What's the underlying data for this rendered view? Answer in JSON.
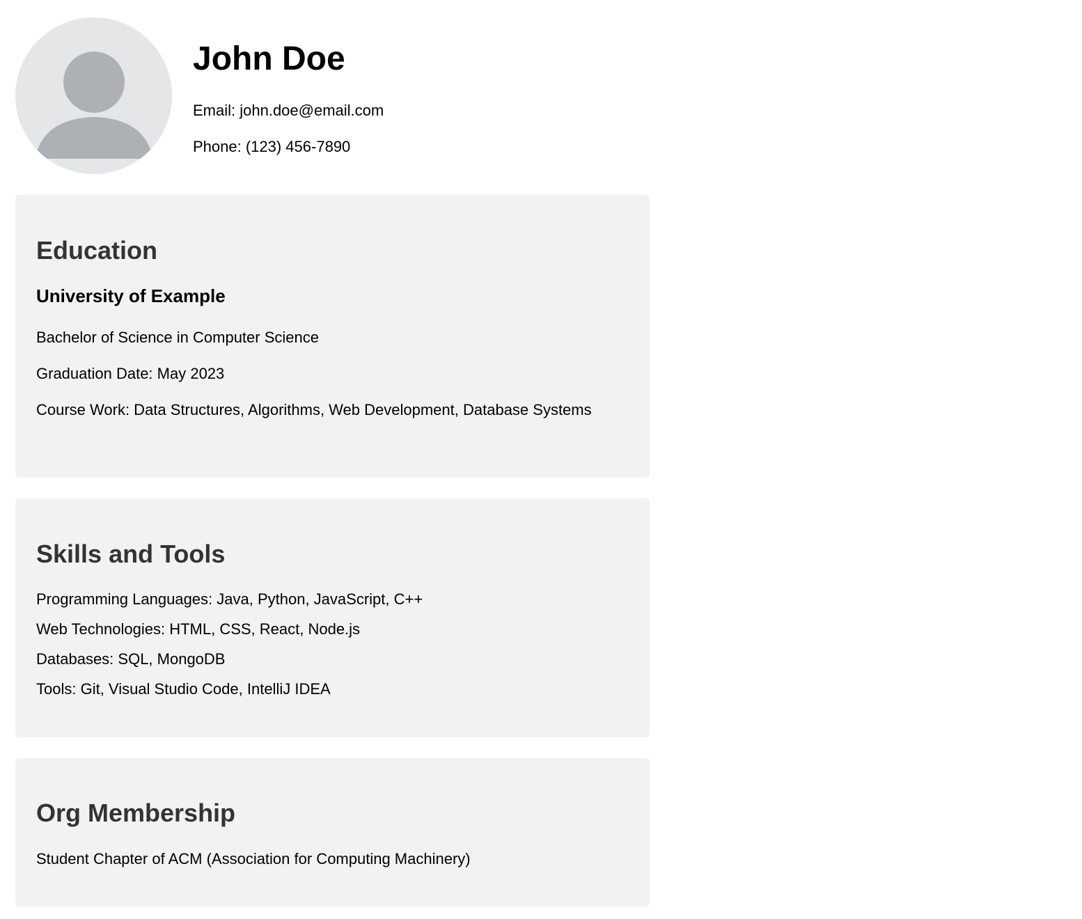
{
  "profile": {
    "name": "John Doe",
    "email": "Email: john.doe@email.com",
    "phone": "Phone: (123) 456-7890",
    "avatar_icon": "user-silhouette-icon"
  },
  "education": {
    "title": "Education",
    "school": "University of Example",
    "degree": "Bachelor of Science in Computer Science",
    "graduation": "Graduation Date: May 2023",
    "coursework": "Course Work: Data Structures, Algorithms, Web Development, Database Systems"
  },
  "skills": {
    "title": "Skills and Tools",
    "items": [
      "Programming Languages: Java, Python, JavaScript, C++",
      "Web Technologies: HTML, CSS, React, Node.js",
      "Databases: SQL, MongoDB",
      "Tools: Git, Visual Studio Code, IntelliJ IDEA"
    ]
  },
  "org": {
    "title": "Org Membership",
    "items": [
      "Student Chapter of ACM (Association for Computing Machinery)"
    ]
  },
  "colors": {
    "card_background": "#f2f2f2",
    "section_heading": "#333333",
    "avatar_background": "#e4e6e8",
    "avatar_figure": "#adb1b5"
  }
}
